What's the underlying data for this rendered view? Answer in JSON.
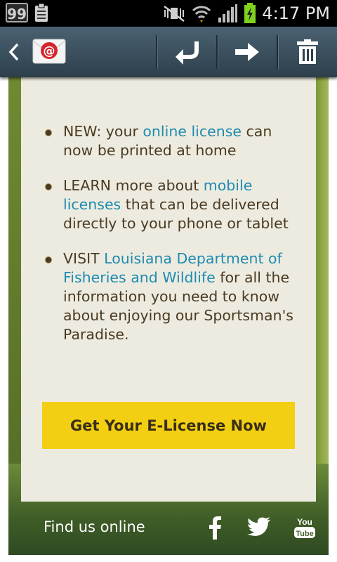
{
  "status_bar": {
    "notification_count": "99",
    "time": "4:17 PM"
  },
  "action_bar": {
    "icons": [
      "back-chevron-icon",
      "email-app-icon",
      "reply-icon",
      "forward-icon",
      "delete-icon"
    ]
  },
  "email": {
    "bullets": [
      {
        "prefix": "NEW: your ",
        "link": "online license",
        "suffix": " can now be printed at home"
      },
      {
        "prefix": "LEARN more about ",
        "link": "mobile licenses",
        "suffix": " that can be delivered directly to your phone or tablet"
      },
      {
        "prefix": "VISIT ",
        "link": "Louisiana Department of Fisheries and Wildlife",
        "suffix": " for all the information you need to know about enjoying our Sportsman's Paradise."
      }
    ],
    "cta_label": "Get Your E-License Now",
    "footer": {
      "find_us": "Find us online",
      "social": [
        "facebook-icon",
        "twitter-icon",
        "youtube-icon"
      ]
    }
  },
  "colors": {
    "link": "#1e8bb0",
    "cta": "#f2cf12",
    "card": "#edebe0",
    "text": "#4a3a22"
  }
}
